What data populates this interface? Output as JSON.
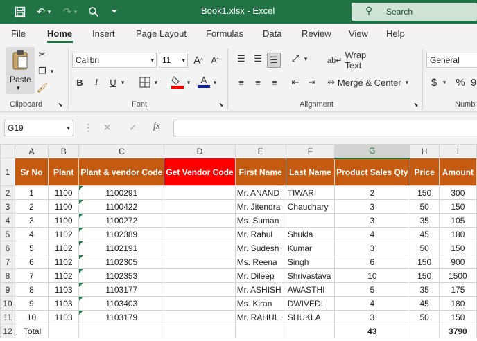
{
  "title_bar": {
    "file_title": "Book1.xlsx  -  Excel",
    "search_label": "Search"
  },
  "tabs": [
    "File",
    "Home",
    "Insert",
    "Page Layout",
    "Formulas",
    "Data",
    "Review",
    "View",
    "Help"
  ],
  "ribbon": {
    "paste_label": "Paste",
    "clipboard_label": "Clipboard",
    "font_name": "Calibri",
    "font_size": "11",
    "font_label": "Font",
    "wrap_text_label": "Wrap Text",
    "merge_center_label": "Merge & Center",
    "alignment_label": "Alignment",
    "number_format": "General",
    "number_label": "Numb"
  },
  "formula_bar": {
    "name_box": "G19",
    "fx": "fx"
  },
  "columns": [
    "A",
    "B",
    "C",
    "D",
    "E",
    "F",
    "G",
    "H",
    "I"
  ],
  "selected_column": "G",
  "header_row": [
    "Sr No",
    "Plant",
    "Plant & vendor Code",
    "Get Vendor Code",
    "First Name",
    "Last Name",
    "Product Sales Qty",
    "Price",
    "Amount"
  ],
  "rows": [
    [
      "1",
      "1100",
      "1100291",
      "",
      "Mr. ANAND",
      "TIWARI",
      "2",
      "150",
      "300"
    ],
    [
      "2",
      "1100",
      "1100422",
      "",
      "Mr. Jitendra",
      "Chaudhary",
      "3",
      "50",
      "150"
    ],
    [
      "3",
      "1100",
      "1100272",
      "",
      "Ms. Suman",
      "",
      "3",
      "35",
      "105"
    ],
    [
      "4",
      "1102",
      "1102389",
      "",
      "Mr. Rahul",
      "Shukla",
      "4",
      "45",
      "180"
    ],
    [
      "5",
      "1102",
      "1102191",
      "",
      "Mr. Sudesh",
      "Kumar",
      "3",
      "50",
      "150"
    ],
    [
      "6",
      "1102",
      "1102305",
      "",
      "Ms. Reena",
      "Singh",
      "6",
      "150",
      "900"
    ],
    [
      "7",
      "1102",
      "1102353",
      "",
      "Mr. Dileep",
      "Shrivastava",
      "10",
      "150",
      "1500"
    ],
    [
      "8",
      "1103",
      "1103177",
      "",
      "Mr. ASHISH",
      "AWASTHI",
      "5",
      "35",
      "175"
    ],
    [
      "9",
      "1103",
      "1103403",
      "",
      "Ms. Kiran",
      "DWIVEDI",
      "4",
      "45",
      "180"
    ],
    [
      "10",
      "1103",
      "1103179",
      "",
      "Mr. RAHUL",
      "SHUKLA",
      "3",
      "50",
      "150"
    ]
  ],
  "total_row": {
    "label": "Total",
    "qty": "43",
    "amount": "3790"
  },
  "row_numbers": [
    "1",
    "2",
    "3",
    "4",
    "5",
    "6",
    "7",
    "8",
    "9",
    "10",
    "11",
    "12"
  ]
}
